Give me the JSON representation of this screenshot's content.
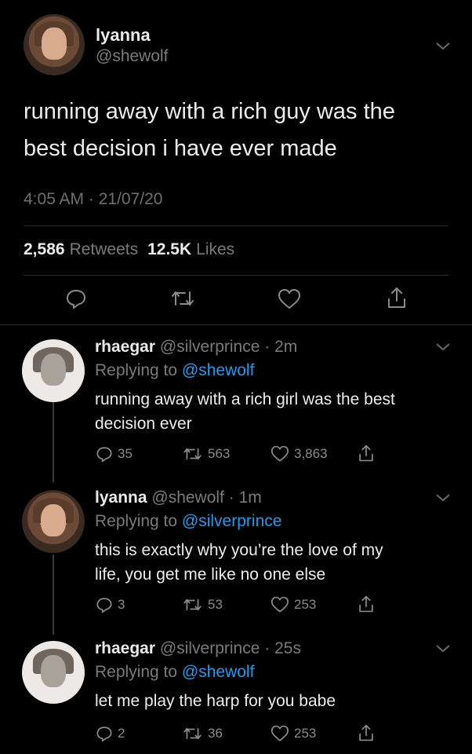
{
  "main_tweet": {
    "display_name": "lyanna",
    "handle": "@shewolf",
    "text_line1": "running away with a rich guy was the",
    "text_line2": "best decision i have ever made",
    "timestamp": "4:05 AM · 21/07/20",
    "retweets_count": "2,586",
    "retweets_label": "Retweets",
    "likes_count": "12.5K",
    "likes_label": "Likes"
  },
  "replies": [
    {
      "display_name": "rhaegar",
      "handle": "@silverprince",
      "time": "· 2m",
      "replying_label": "Replying to",
      "replying_to": "@shewolf",
      "text_line1": "running away with a rich girl was the best",
      "text_line2": "decision ever",
      "replies": "35",
      "retweets": "563",
      "likes": "3,863"
    },
    {
      "display_name": "lyanna",
      "handle": "@shewolf",
      "time": "· 1m",
      "replying_label": "Replying to",
      "replying_to": "@silverprince",
      "text_line1": "this is exactly why you’re the love of my",
      "text_line2": "life, you get me like no one else",
      "replies": "3",
      "retweets": "53",
      "likes": "253"
    },
    {
      "display_name": "rhaegar",
      "handle": "@silverprince",
      "time": "· 25s",
      "replying_label": "Replying to",
      "replying_to": "@shewolf",
      "text_line1": "let me play the harp for you babe",
      "replies": "2",
      "retweets": "36",
      "likes": "253"
    }
  ],
  "colors": {
    "background": "#000000",
    "link": "#1d9bf0",
    "secondary_text": "#7a7a7a"
  }
}
